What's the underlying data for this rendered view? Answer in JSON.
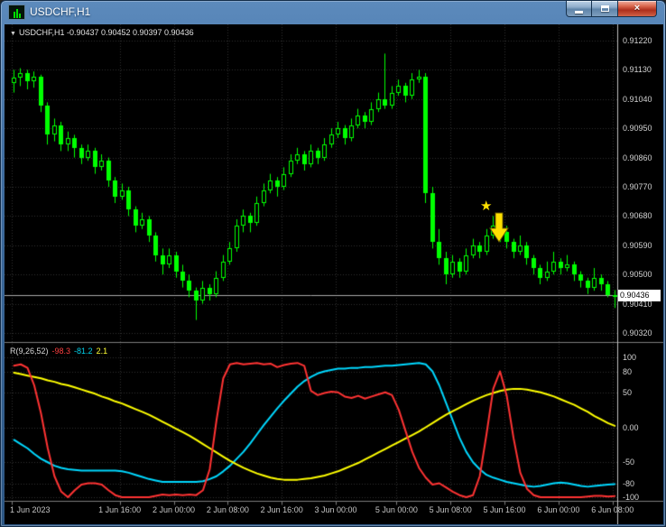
{
  "window": {
    "title": "USDCHF,H1",
    "close_glyph": "×"
  },
  "chart": {
    "header": {
      "dropdown_glyph": "▼",
      "text": "USDCHF,H1 -0.90437 0.90452 0.90397 0.90436"
    }
  },
  "price_axis": {
    "labels": [
      "0.91220",
      "0.91130",
      "0.91040",
      "0.90950",
      "0.90860",
      "0.90770",
      "0.90680",
      "0.90590",
      "0.90500",
      "0.90410",
      "0.90320"
    ],
    "current_price": "0.90436"
  },
  "time_axis": {
    "labels": [
      {
        "text": "1 Jun 2023",
        "index": 0
      },
      {
        "text": "1 Jun 16:00",
        "index": 16
      },
      {
        "text": "2 Jun 00:00",
        "index": 24
      },
      {
        "text": "2 Jun 08:00",
        "index": 32
      },
      {
        "text": "2 Jun 16:00",
        "index": 40
      },
      {
        "text": "3 Jun 00:00",
        "index": 48
      },
      {
        "text": "5 Jun 00:00",
        "index": 57
      },
      {
        "text": "5 Jun 08:00",
        "index": 65
      },
      {
        "text": "5 Jun 16:00",
        "index": 73
      },
      {
        "text": "6 Jun 00:00",
        "index": 81
      },
      {
        "text": "6 Jun 08:00",
        "index": 89
      }
    ]
  },
  "indicator": {
    "name": "R(9,26,52)",
    "values": [
      {
        "text": "-98.3",
        "color": "#ff4040"
      },
      {
        "text": "-81.2",
        "color": "#00d4ee"
      },
      {
        "text": "2.1",
        "color": "#ffff33"
      }
    ],
    "scale_labels": [
      {
        "text": "100",
        "value": 100
      },
      {
        "text": "80",
        "value": 80
      },
      {
        "text": "50",
        "value": 50
      },
      {
        "text": "0.00",
        "value": 0
      },
      {
        "text": "-50",
        "value": -50
      },
      {
        "text": "-80",
        "value": -80
      },
      {
        "text": "-100",
        "value": -100
      }
    ],
    "grid_levels": [
      100,
      80,
      50,
      0,
      -50,
      -80,
      -100
    ]
  },
  "colors": {
    "background": "#000000",
    "grid": "#303030",
    "candle": "#00ff00",
    "separator": "#7d7d7d",
    "axis_line": "#c0c0c0",
    "bid_line": "#a8a8a8",
    "red_line": "#ff3333",
    "aqua_line": "#00d8ff",
    "yellow_line": "#ffff00"
  },
  "annotation": {
    "star_glyph": "★",
    "arrow": "down-arrow",
    "color": "#ffdf00"
  },
  "chart_data": {
    "type": "candlestick",
    "symbol": "USDCHF",
    "timeframe": "H1",
    "price_axis_top": 0.9122,
    "price_axis_bottom": 0.9032,
    "candles": [
      [
        0.9109,
        0.9113,
        0.9106,
        0.91105
      ],
      [
        0.91105,
        0.91135,
        0.9108,
        0.9112
      ],
      [
        0.9112,
        0.9113,
        0.9107,
        0.91095
      ],
      [
        0.91095,
        0.91125,
        0.91075,
        0.9111
      ],
      [
        0.9111,
        0.91115,
        0.91,
        0.9102
      ],
      [
        0.9102,
        0.9103,
        0.909,
        0.9093
      ],
      [
        0.9093,
        0.9098,
        0.9091,
        0.9096
      ],
      [
        0.9096,
        0.9097,
        0.9088,
        0.909
      ],
      [
        0.909,
        0.9094,
        0.9088,
        0.9092
      ],
      [
        0.9092,
        0.9093,
        0.9086,
        0.9089
      ],
      [
        0.9089,
        0.909,
        0.9084,
        0.9086
      ],
      [
        0.9086,
        0.909,
        0.9085,
        0.9088
      ],
      [
        0.9088,
        0.9089,
        0.9081,
        0.9083
      ],
      [
        0.9083,
        0.9087,
        0.9082,
        0.9085
      ],
      [
        0.9085,
        0.9086,
        0.9077,
        0.9079
      ],
      [
        0.9079,
        0.908,
        0.9072,
        0.9074
      ],
      [
        0.9074,
        0.9078,
        0.9073,
        0.9076
      ],
      [
        0.9076,
        0.9077,
        0.9068,
        0.907
      ],
      [
        0.907,
        0.9071,
        0.9063,
        0.9065
      ],
      [
        0.9065,
        0.9069,
        0.9064,
        0.9067
      ],
      [
        0.9067,
        0.9068,
        0.906,
        0.9062
      ],
      [
        0.9062,
        0.9063,
        0.9054,
        0.9056
      ],
      [
        0.9056,
        0.9058,
        0.905,
        0.9053
      ],
      [
        0.9053,
        0.9058,
        0.9052,
        0.9056
      ],
      [
        0.9056,
        0.9057,
        0.9049,
        0.9051
      ],
      [
        0.9051,
        0.9053,
        0.9046,
        0.9048
      ],
      [
        0.9048,
        0.905,
        0.9043,
        0.9045
      ],
      [
        0.9045,
        0.9046,
        0.9036,
        0.9042
      ],
      [
        0.9042,
        0.9048,
        0.9041,
        0.9046
      ],
      [
        0.9046,
        0.9047,
        0.9042,
        0.9044
      ],
      [
        0.9044,
        0.9051,
        0.9043,
        0.9049
      ],
      [
        0.9049,
        0.9056,
        0.9048,
        0.9054
      ],
      [
        0.9054,
        0.906,
        0.9053,
        0.9058
      ],
      [
        0.9058,
        0.9067,
        0.9057,
        0.9065
      ],
      [
        0.9065,
        0.907,
        0.9063,
        0.9068
      ],
      [
        0.9068,
        0.9069,
        0.9063,
        0.9066
      ],
      [
        0.9066,
        0.9074,
        0.9065,
        0.9072
      ],
      [
        0.9072,
        0.9078,
        0.9071,
        0.9076
      ],
      [
        0.9076,
        0.9081,
        0.9075,
        0.9079
      ],
      [
        0.9079,
        0.908,
        0.9074,
        0.9077
      ],
      [
        0.9077,
        0.9083,
        0.9076,
        0.9081
      ],
      [
        0.9081,
        0.9087,
        0.908,
        0.9085
      ],
      [
        0.9085,
        0.9089,
        0.9084,
        0.9087
      ],
      [
        0.9087,
        0.9088,
        0.9082,
        0.9084
      ],
      [
        0.9084,
        0.909,
        0.9083,
        0.9088
      ],
      [
        0.9088,
        0.9089,
        0.9084,
        0.9086
      ],
      [
        0.9086,
        0.9092,
        0.9085,
        0.909
      ],
      [
        0.909,
        0.9095,
        0.9089,
        0.9093
      ],
      [
        0.9093,
        0.9097,
        0.9092,
        0.9095
      ],
      [
        0.9095,
        0.9096,
        0.909,
        0.9092
      ],
      [
        0.9092,
        0.9098,
        0.9091,
        0.9096
      ],
      [
        0.9096,
        0.9101,
        0.9095,
        0.9099
      ],
      [
        0.9099,
        0.91,
        0.9095,
        0.9097
      ],
      [
        0.9097,
        0.9103,
        0.9096,
        0.9101
      ],
      [
        0.9101,
        0.9106,
        0.91,
        0.9104
      ],
      [
        0.9104,
        0.9118,
        0.9101,
        0.9102
      ],
      [
        0.9102,
        0.9108,
        0.9101,
        0.9106
      ],
      [
        0.9106,
        0.911,
        0.9105,
        0.9108
      ],
      [
        0.9108,
        0.9109,
        0.9103,
        0.9105
      ],
      [
        0.9105,
        0.9112,
        0.9104,
        0.911
      ],
      [
        0.911,
        0.9113,
        0.9109,
        0.9111
      ],
      [
        0.9111,
        0.9112,
        0.9072,
        0.9075
      ],
      [
        0.9075,
        0.9077,
        0.9058,
        0.906
      ],
      [
        0.906,
        0.9064,
        0.9053,
        0.9055
      ],
      [
        0.9055,
        0.9057,
        0.9047,
        0.905
      ],
      [
        0.905,
        0.9056,
        0.9049,
        0.9054
      ],
      [
        0.9054,
        0.9055,
        0.9049,
        0.9051
      ],
      [
        0.9051,
        0.9058,
        0.905,
        0.9056
      ],
      [
        0.9056,
        0.9061,
        0.9055,
        0.9059
      ],
      [
        0.9059,
        0.906,
        0.9055,
        0.9057
      ],
      [
        0.9057,
        0.9064,
        0.9056,
        0.9062
      ],
      [
        0.9062,
        0.9068,
        0.9061,
        0.9065
      ],
      [
        0.9065,
        0.9066,
        0.906,
        0.9063
      ],
      [
        0.9063,
        0.9065,
        0.9058,
        0.906
      ],
      [
        0.906,
        0.9061,
        0.9055,
        0.9057
      ],
      [
        0.9057,
        0.9062,
        0.9056,
        0.9059
      ],
      [
        0.9059,
        0.906,
        0.9053,
        0.9055
      ],
      [
        0.9055,
        0.9056,
        0.905,
        0.9052
      ],
      [
        0.9052,
        0.9053,
        0.9047,
        0.9049
      ],
      [
        0.9049,
        0.9054,
        0.9048,
        0.9051
      ],
      [
        0.9051,
        0.9057,
        0.905,
        0.9054
      ],
      [
        0.9054,
        0.9055,
        0.905,
        0.9052
      ],
      [
        0.9052,
        0.9056,
        0.9051,
        0.9053
      ],
      [
        0.9053,
        0.9054,
        0.9048,
        0.905
      ],
      [
        0.905,
        0.9051,
        0.9046,
        0.9048
      ],
      [
        0.9048,
        0.9049,
        0.9044,
        0.9046
      ],
      [
        0.9046,
        0.9052,
        0.9045,
        0.9049
      ],
      [
        0.9049,
        0.905,
        0.9045,
        0.9047
      ],
      [
        0.9047,
        0.9048,
        0.9043,
        0.90437
      ],
      [
        0.90437,
        0.90452,
        0.90397,
        0.90436
      ]
    ],
    "oscillator": {
      "range": [
        -100,
        100
      ],
      "series": [
        {
          "name": "line-9",
          "color": "#ff3333",
          "values": [
            88,
            90,
            85,
            60,
            20,
            -30,
            -70,
            -92,
            -100,
            -90,
            -82,
            -80,
            -80,
            -82,
            -90,
            -97,
            -100,
            -100,
            -100,
            -100,
            -100,
            -98,
            -96,
            -97,
            -96,
            -97,
            -96,
            -97,
            -90,
            -60,
            10,
            70,
            90,
            92,
            90,
            91,
            92,
            90,
            91,
            86,
            89,
            91,
            92,
            88,
            52,
            46,
            49,
            51,
            50,
            44,
            42,
            45,
            41,
            44,
            47,
            50,
            46,
            25,
            -5,
            -35,
            -58,
            -72,
            -82,
            -80,
            -86,
            -92,
            -97,
            -100,
            -97,
            -70,
            -10,
            55,
            80,
            45,
            -15,
            -65,
            -88,
            -97,
            -100,
            -100,
            -100,
            -100,
            -100,
            -100,
            -100,
            -99,
            -98,
            -98,
            -99,
            -98.3
          ]
        },
        {
          "name": "line-26",
          "color": "#00d8ff",
          "values": [
            -18,
            -24,
            -30,
            -38,
            -45,
            -50,
            -55,
            -58,
            -60,
            -61,
            -62,
            -62,
            -62,
            -62,
            -62,
            -62,
            -63,
            -65,
            -68,
            -71,
            -74,
            -76,
            -78,
            -78,
            -78,
            -78,
            -78,
            -78,
            -77,
            -74,
            -70,
            -63,
            -55,
            -45,
            -35,
            -23,
            -10,
            3,
            15,
            27,
            38,
            48,
            58,
            66,
            72,
            77,
            80,
            82,
            84,
            84,
            85,
            85,
            86,
            86,
            87,
            88,
            88,
            89,
            90,
            91,
            92,
            90,
            80,
            60,
            35,
            10,
            -15,
            -35,
            -50,
            -60,
            -68,
            -72,
            -75,
            -78,
            -80,
            -82,
            -84,
            -85,
            -84,
            -82,
            -80,
            -79,
            -80,
            -82,
            -84,
            -85,
            -84,
            -83,
            -82,
            -81.2
          ]
        },
        {
          "name": "line-52",
          "color": "#ffff00",
          "values": [
            78,
            76,
            74,
            72,
            70,
            67,
            65,
            62,
            60,
            57,
            54,
            51,
            48,
            44,
            41,
            37,
            34,
            30,
            26,
            22,
            18,
            13,
            8,
            3,
            -2,
            -7,
            -12,
            -18,
            -24,
            -30,
            -36,
            -42,
            -48,
            -53,
            -58,
            -62,
            -66,
            -69,
            -72,
            -74,
            -75,
            -75,
            -75,
            -74,
            -73,
            -71,
            -69,
            -66,
            -63,
            -59,
            -55,
            -51,
            -46,
            -41,
            -36,
            -31,
            -26,
            -21,
            -16,
            -11,
            -6,
            0,
            6,
            12,
            18,
            23,
            28,
            33,
            38,
            42,
            46,
            49,
            52,
            54,
            55,
            55,
            54,
            52,
            50,
            47,
            44,
            40,
            36,
            32,
            27,
            22,
            16,
            11,
            6,
            2.1
          ]
        }
      ]
    }
  }
}
